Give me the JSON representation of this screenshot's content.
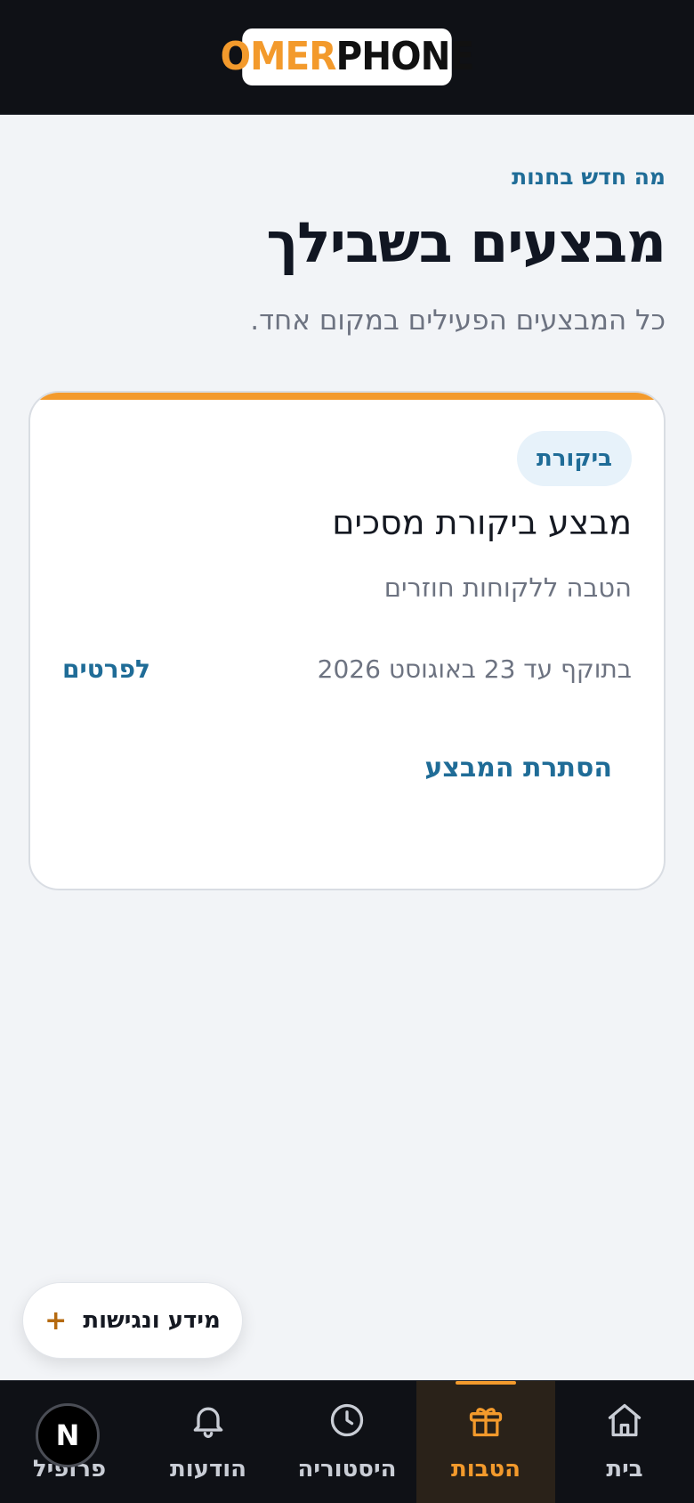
{
  "header": {
    "logo_part1": "OMER",
    "logo_part2": "PHONE"
  },
  "intro": {
    "eyebrow": "מה חדש בחנות",
    "title": "מבצעים בשבילך",
    "subtitle": "כל המבצעים הפעילים במקום אחד."
  },
  "offer": {
    "badge": "ביקורת",
    "title": "מבצע ביקורת מסכים",
    "subtitle": "הטבה ללקוחות חוזרים",
    "valid_until": "בתוקף עד 23 באוגוסט 2026",
    "details_link": "לפרטים",
    "hide_button": "הסתרת המבצע"
  },
  "info_pill": {
    "label": "מידע ונגישות",
    "plus": "+"
  },
  "bottom_nav": {
    "items": [
      {
        "label": "בית",
        "icon": "home-icon",
        "active": false
      },
      {
        "label": "הטבות",
        "icon": "gift-icon",
        "active": true
      },
      {
        "label": "היסטוריה",
        "icon": "clock-icon",
        "active": false
      },
      {
        "label": "הודעות",
        "icon": "bell-icon",
        "active": false
      },
      {
        "label": "פרופיל",
        "icon": "user-icon",
        "active": false
      }
    ]
  },
  "dev_badge": {
    "letter": "N"
  },
  "colors": {
    "brand_orange": "#f39a2c",
    "link_blue": "#1f6c97",
    "dark_bg": "#0f1116",
    "page_bg": "#f2f4f7"
  }
}
